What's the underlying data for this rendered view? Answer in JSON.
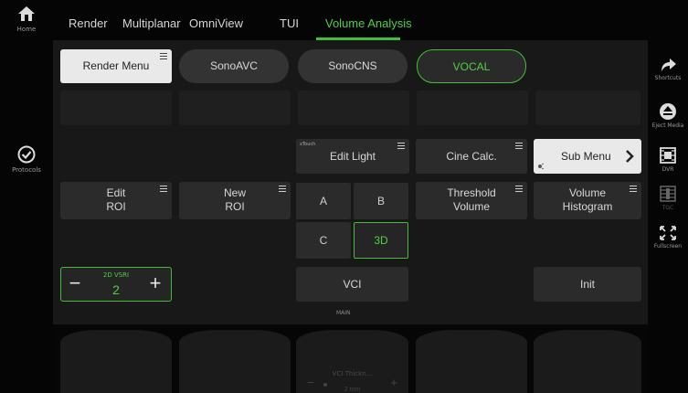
{
  "tabs": [
    "Render",
    "Multiplanar",
    "OmniView",
    "TUI",
    "Volume Analysis"
  ],
  "active_tab": "Volume Analysis",
  "left_rail": {
    "home_label": "Home",
    "protocols_label": "Protocols"
  },
  "right_rail": {
    "shortcuts_label": "Shortcuts",
    "eject_label": "Eject Media",
    "dvr_label": "DVR",
    "tgc_label": "TGC",
    "fullscreen_label": "Fullscreen"
  },
  "mode_row": {
    "render_menu": "Render Menu",
    "sonoavc": "SonoAVC",
    "sonocns": "SonoCNS",
    "vocal": "VOCAL"
  },
  "controls": {
    "xtouch_label": "xTouch",
    "edit_light": "Edit Light",
    "cine_calc": "Cine Calc.",
    "sub_menu": "Sub Menu",
    "edit_roi_1": "Edit",
    "edit_roi_2": "ROI",
    "new_roi_1": "New",
    "new_roi_2": "ROI",
    "threshold_1": "Threshold",
    "threshold_2": "Volume",
    "histogram_1": "Volume",
    "histogram_2": "Histogram",
    "grid_a": "A",
    "grid_b": "B",
    "grid_c": "C",
    "grid_3d": "3D",
    "vci": "VCI",
    "init": "Init",
    "main_label": "MAIN",
    "vsri_label": "2D VSRI",
    "vsri_value": "2"
  },
  "bottom": {
    "vci_thickness_label": "VCI Thickn...",
    "vci_thickness_value": "2 mm"
  },
  "colors": {
    "accent": "#3fc133",
    "panel": "#181818"
  }
}
